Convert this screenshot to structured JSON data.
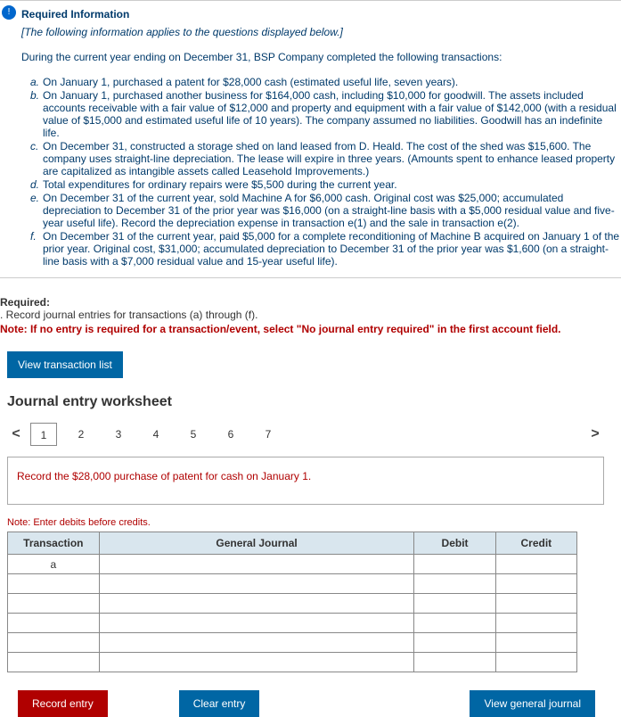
{
  "info": {
    "badge": "!",
    "title": "Required Information",
    "applies": "[The following information applies to the questions displayed below.]",
    "intro": "During the current year ending on December 31, BSP Company completed the following transactions:",
    "items": [
      {
        "letter": "a.",
        "text": "On January 1, purchased a patent for $28,000 cash (estimated useful life, seven years)."
      },
      {
        "letter": "b.",
        "text": "On January 1, purchased another business for $164,000 cash, including $10,000 for goodwill. The assets included accounts receivable with a fair value of $12,000 and property and equipment with a fair value of $142,000 (with a residual value of $15,000 and estimated useful life of 10 years). The company assumed no liabilities. Goodwill has an indefinite life."
      },
      {
        "letter": "c.",
        "text": "On December 31, constructed a storage shed on land leased from D. Heald. The cost of the shed was $15,600. The company uses straight-line depreciation. The lease will expire in three years. (Amounts spent to enhance leased property are capitalized as intangible assets called Leasehold Improvements.)"
      },
      {
        "letter": "d.",
        "text": "Total expenditures for ordinary repairs were $5,500 during the current year."
      },
      {
        "letter": "e.",
        "text": "On December 31 of the current year, sold Machine A for $6,000 cash. Original cost was $25,000; accumulated depreciation to December 31 of the prior year was $16,000 (on a straight-line basis with a $5,000 residual value and five-year useful life). Record the depreciation expense in transaction e(1) and the sale in transaction e(2)."
      },
      {
        "letter": "f.",
        "text": "On December 31 of the current year, paid $5,000 for a complete reconditioning of Machine B acquired on January 1 of the prior year. Original cost, $31,000; accumulated depreciation to December 31 of the prior year was $1,600 (on a straight-line basis with a $7,000 residual value and 15-year useful life)."
      }
    ]
  },
  "required": {
    "header": "Required:",
    "line": ". Record journal entries for transactions (a) through (f).",
    "note": "Note: If no entry is required for a transaction/event, select \"No journal entry required\" in the first account field."
  },
  "view_btn": "View transaction list",
  "worksheet": {
    "title": "Journal entry worksheet",
    "chev_left": "<",
    "chev_right": ">",
    "tabs": [
      "1",
      "2",
      "3",
      "4",
      "5",
      "6",
      "7"
    ],
    "active_tab": "1",
    "prompt": "Record the $28,000 purchase of patent for cash on January 1.",
    "note": "Note: Enter debits before credits.",
    "headers": {
      "tx": "Transaction",
      "gj": "General Journal",
      "dr": "Debit",
      "cr": "Credit"
    },
    "row_label": "a",
    "buttons": {
      "record": "Record entry",
      "clear": "Clear entry",
      "view": "View general journal"
    }
  }
}
